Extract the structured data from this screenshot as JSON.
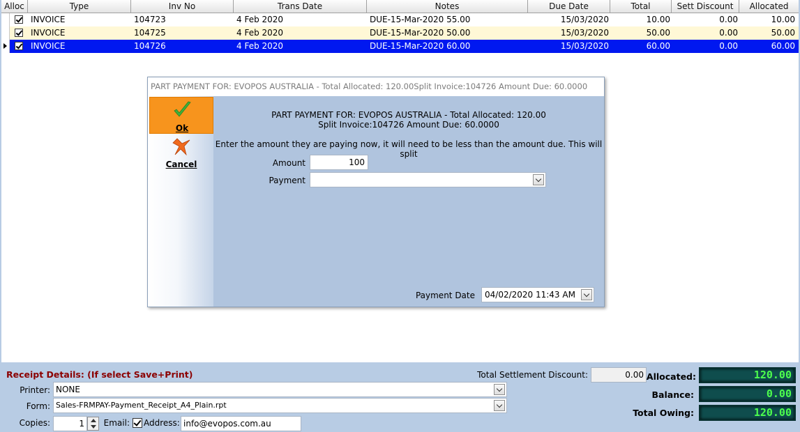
{
  "grid": {
    "headers": [
      "Alloc",
      "Type",
      "Inv No",
      "Trans Date",
      "Notes",
      "Due Date",
      "Total",
      "Sett Discount",
      "Allocated"
    ],
    "rows": [
      {
        "type": "INVOICE",
        "inv_no": "104723",
        "trans_date": "4 Feb 2020",
        "notes": "DUE-15-Mar-2020 55.00",
        "due_date": "15/03/2020",
        "total": "10.00",
        "sett_discount": "0.00",
        "allocated": "10.00",
        "checked": true
      },
      {
        "type": "INVOICE",
        "inv_no": "104725",
        "trans_date": "4 Feb 2020",
        "notes": "DUE-15-Mar-2020 50.00",
        "due_date": "15/03/2020",
        "total": "50.00",
        "sett_discount": "0.00",
        "allocated": "50.00",
        "checked": true
      },
      {
        "type": "INVOICE",
        "inv_no": "104726",
        "trans_date": "4 Feb 2020",
        "notes": "DUE-15-Mar-2020 60.00",
        "due_date": "15/03/2020",
        "total": "60.00",
        "sett_discount": "0.00",
        "allocated": "60.00",
        "checked": true,
        "selected": true
      }
    ]
  },
  "dialog": {
    "title": "PART PAYMENT FOR: EVOPOS AUSTRALIA - Total Allocated: 120.00Split Invoice:104726 Amount Due: 60.0000",
    "ok_label": "Ok",
    "cancel_label": "Cancel",
    "heading_line1": "PART PAYMENT FOR: EVOPOS AUSTRALIA - Total Allocated: 120.00",
    "heading_line2": "Split Invoice:104726 Amount Due: 60.0000",
    "instruction": "Enter the amount they are paying now, it will need to be less than the amount due. This will split",
    "amount_label": "Amount",
    "amount_value": "100",
    "payment_label": "Payment",
    "payment_value": "",
    "payment_date_label": "Payment Date",
    "payment_date_value": "04/02/2020 11:43 AM"
  },
  "receipt": {
    "title": "Receipt Details: (If select Save+Print)",
    "printer_label": "Printer:",
    "printer_value": "NONE",
    "form_label": "Form:",
    "form_value": "Sales-FRMPAY-Payment_Receipt_A4_Plain.rpt",
    "copies_label": "Copies:",
    "copies_value": "1",
    "email_label": "Email:",
    "email_checked": true,
    "address_label": "Address:",
    "address_value": "info@evopos.com.au"
  },
  "totals": {
    "settlement_discount_label": "Total Settlement Discount:",
    "settlement_discount_value": "0.00",
    "allocated_label": "Allocated:",
    "allocated_value": "120.00",
    "balance_label": "Balance:",
    "balance_value": "0.00",
    "total_owing_label": "Total Owing:",
    "total_owing_value": "120.00"
  },
  "colors": {
    "selected_row": "#0018f0",
    "alt_row": "#fff8d6",
    "panel_bg": "#b8cce4",
    "ok_button": "#f7941d",
    "lcd_text": "#4dff4d",
    "receipt_title": "#8b0000"
  },
  "icons": {
    "ok": "green-checkmark-icon",
    "cancel": "orange-cancel-arrow-icon",
    "row_pointer": "row-pointer-icon",
    "dropdown": "chevron-down-icon"
  }
}
